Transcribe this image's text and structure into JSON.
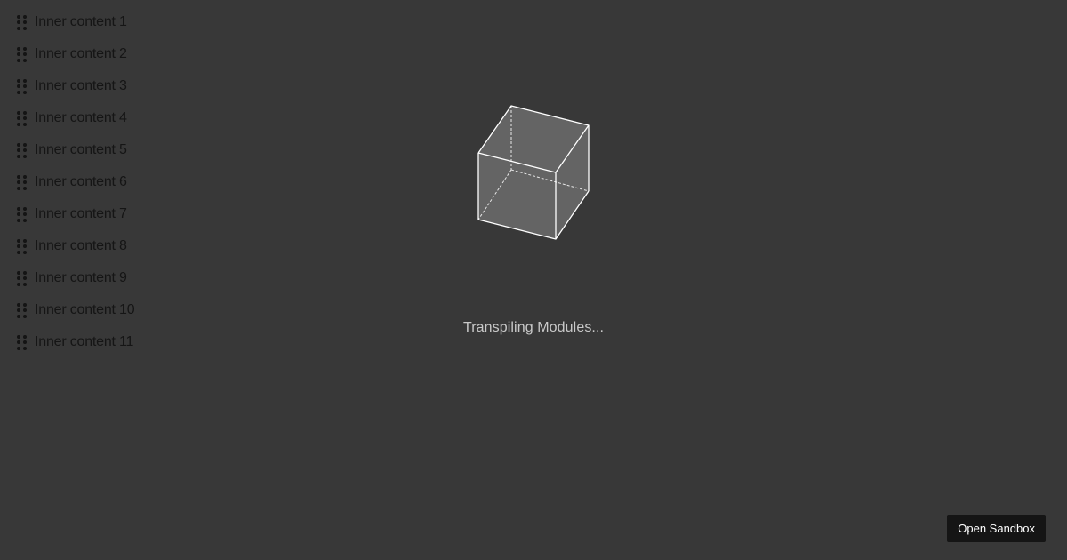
{
  "list": {
    "items": [
      {
        "label": "Inner content 1"
      },
      {
        "label": "Inner content 2"
      },
      {
        "label": "Inner content 3"
      },
      {
        "label": "Inner content 4"
      },
      {
        "label": "Inner content 5"
      },
      {
        "label": "Inner content 6"
      },
      {
        "label": "Inner content 7"
      },
      {
        "label": "Inner content 8"
      },
      {
        "label": "Inner content 9"
      },
      {
        "label": "Inner content 10"
      },
      {
        "label": "Inner content 11"
      }
    ],
    "handle_icon": "drag-handle-icon"
  },
  "loader": {
    "icon": "cube-icon",
    "status_text": "Transpiling Modules..."
  },
  "open_sandbox": {
    "label": "Open Sandbox"
  },
  "colors": {
    "background": "#383838",
    "item_text": "#151515",
    "status_text": "#c9c9c9",
    "button_bg": "#151515",
    "button_text": "#ffffff",
    "cube_face": "#646464",
    "cube_edge": "#ffffff"
  }
}
